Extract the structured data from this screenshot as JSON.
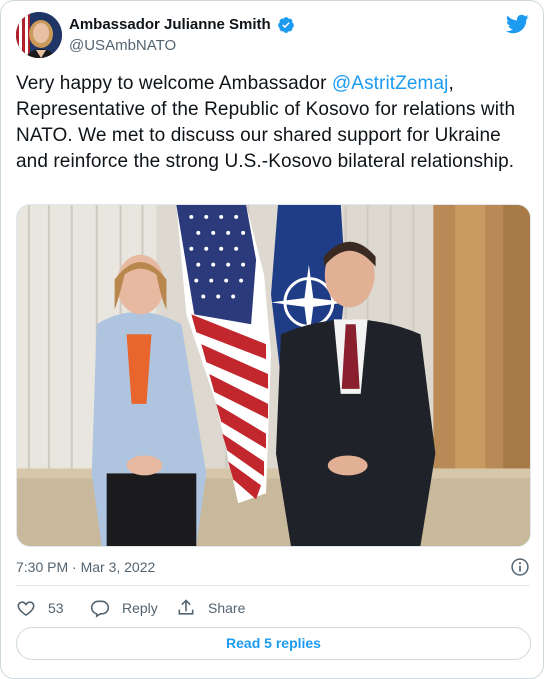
{
  "author": {
    "display_name": "Ambassador Julianne Smith",
    "handle": "@USAmbNATO"
  },
  "tweet": {
    "text_before": "Very happy to welcome Ambassador ",
    "mention": "@AstritZemaj",
    "text_after": ", Representative of the Republic of Kosovo for relations with NATO. We met to discuss our shared support for Ukraine and reinforce the strong U.S.-Kosovo bilateral relationship.",
    "timestamp": "7:30 PM · Mar 3, 2022"
  },
  "actions": {
    "like_count": "53",
    "reply_label": "Reply",
    "share_label": "Share"
  },
  "read_replies_label": "Read 5 replies",
  "colors": {
    "accent": "#1d9bf0",
    "secondary_text": "#536471",
    "border": "#cfd9de"
  },
  "icons": [
    "twitter-bird-icon",
    "verified-badge-icon",
    "info-icon",
    "heart-icon",
    "reply-bubble-icon",
    "share-icon"
  ]
}
